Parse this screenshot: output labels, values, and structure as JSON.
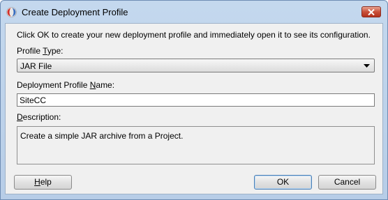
{
  "dialog": {
    "title": "Create Deployment Profile",
    "icon": "oracle-jdeveloper-icon",
    "close_icon": "close-icon"
  },
  "instructions": "Click OK to create your new deployment profile and immediately open it to see its configuration.",
  "profile_type": {
    "label_pre": "Profile ",
    "label_mnemonic": "T",
    "label_post": "ype:",
    "selected": "JAR File"
  },
  "profile_name": {
    "label_pre": "Deployment Profile ",
    "label_mnemonic": "N",
    "label_post": "ame:",
    "value": "SiteCC"
  },
  "description": {
    "label_pre": "",
    "label_mnemonic": "D",
    "label_post": "escription:",
    "value": "Create a simple JAR archive from a Project."
  },
  "buttons": {
    "help_mnemonic": "H",
    "help_post": "elp",
    "ok": "OK",
    "cancel": "Cancel"
  },
  "colors": {
    "title_bar": "#c4d8ee",
    "client_bg": "#f0f0f0",
    "close_button": "#c9503a"
  }
}
